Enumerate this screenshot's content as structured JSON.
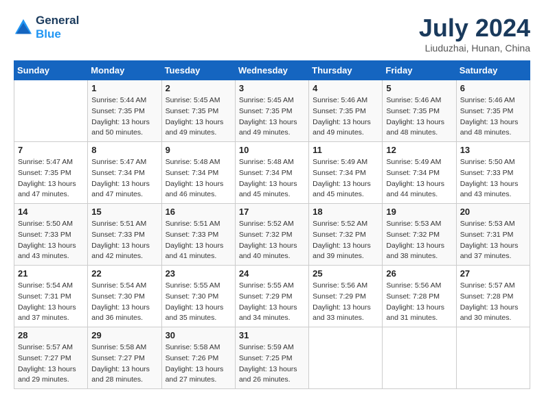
{
  "header": {
    "logo_line1": "General",
    "logo_line2": "Blue",
    "month": "July 2024",
    "location": "Liuduzhai, Hunan, China"
  },
  "weekdays": [
    "Sunday",
    "Monday",
    "Tuesday",
    "Wednesday",
    "Thursday",
    "Friday",
    "Saturday"
  ],
  "weeks": [
    [
      {
        "day": "",
        "sunrise": "",
        "sunset": "",
        "daylight": ""
      },
      {
        "day": "1",
        "sunrise": "Sunrise: 5:44 AM",
        "sunset": "Sunset: 7:35 PM",
        "daylight": "Daylight: 13 hours and 50 minutes."
      },
      {
        "day": "2",
        "sunrise": "Sunrise: 5:45 AM",
        "sunset": "Sunset: 7:35 PM",
        "daylight": "Daylight: 13 hours and 49 minutes."
      },
      {
        "day": "3",
        "sunrise": "Sunrise: 5:45 AM",
        "sunset": "Sunset: 7:35 PM",
        "daylight": "Daylight: 13 hours and 49 minutes."
      },
      {
        "day": "4",
        "sunrise": "Sunrise: 5:46 AM",
        "sunset": "Sunset: 7:35 PM",
        "daylight": "Daylight: 13 hours and 49 minutes."
      },
      {
        "day": "5",
        "sunrise": "Sunrise: 5:46 AM",
        "sunset": "Sunset: 7:35 PM",
        "daylight": "Daylight: 13 hours and 48 minutes."
      },
      {
        "day": "6",
        "sunrise": "Sunrise: 5:46 AM",
        "sunset": "Sunset: 7:35 PM",
        "daylight": "Daylight: 13 hours and 48 minutes."
      }
    ],
    [
      {
        "day": "7",
        "sunrise": "Sunrise: 5:47 AM",
        "sunset": "Sunset: 7:35 PM",
        "daylight": "Daylight: 13 hours and 47 minutes."
      },
      {
        "day": "8",
        "sunrise": "Sunrise: 5:47 AM",
        "sunset": "Sunset: 7:34 PM",
        "daylight": "Daylight: 13 hours and 47 minutes."
      },
      {
        "day": "9",
        "sunrise": "Sunrise: 5:48 AM",
        "sunset": "Sunset: 7:34 PM",
        "daylight": "Daylight: 13 hours and 46 minutes."
      },
      {
        "day": "10",
        "sunrise": "Sunrise: 5:48 AM",
        "sunset": "Sunset: 7:34 PM",
        "daylight": "Daylight: 13 hours and 45 minutes."
      },
      {
        "day": "11",
        "sunrise": "Sunrise: 5:49 AM",
        "sunset": "Sunset: 7:34 PM",
        "daylight": "Daylight: 13 hours and 45 minutes."
      },
      {
        "day": "12",
        "sunrise": "Sunrise: 5:49 AM",
        "sunset": "Sunset: 7:34 PM",
        "daylight": "Daylight: 13 hours and 44 minutes."
      },
      {
        "day": "13",
        "sunrise": "Sunrise: 5:50 AM",
        "sunset": "Sunset: 7:33 PM",
        "daylight": "Daylight: 13 hours and 43 minutes."
      }
    ],
    [
      {
        "day": "14",
        "sunrise": "Sunrise: 5:50 AM",
        "sunset": "Sunset: 7:33 PM",
        "daylight": "Daylight: 13 hours and 43 minutes."
      },
      {
        "day": "15",
        "sunrise": "Sunrise: 5:51 AM",
        "sunset": "Sunset: 7:33 PM",
        "daylight": "Daylight: 13 hours and 42 minutes."
      },
      {
        "day": "16",
        "sunrise": "Sunrise: 5:51 AM",
        "sunset": "Sunset: 7:33 PM",
        "daylight": "Daylight: 13 hours and 41 minutes."
      },
      {
        "day": "17",
        "sunrise": "Sunrise: 5:52 AM",
        "sunset": "Sunset: 7:32 PM",
        "daylight": "Daylight: 13 hours and 40 minutes."
      },
      {
        "day": "18",
        "sunrise": "Sunrise: 5:52 AM",
        "sunset": "Sunset: 7:32 PM",
        "daylight": "Daylight: 13 hours and 39 minutes."
      },
      {
        "day": "19",
        "sunrise": "Sunrise: 5:53 AM",
        "sunset": "Sunset: 7:32 PM",
        "daylight": "Daylight: 13 hours and 38 minutes."
      },
      {
        "day": "20",
        "sunrise": "Sunrise: 5:53 AM",
        "sunset": "Sunset: 7:31 PM",
        "daylight": "Daylight: 13 hours and 37 minutes."
      }
    ],
    [
      {
        "day": "21",
        "sunrise": "Sunrise: 5:54 AM",
        "sunset": "Sunset: 7:31 PM",
        "daylight": "Daylight: 13 hours and 37 minutes."
      },
      {
        "day": "22",
        "sunrise": "Sunrise: 5:54 AM",
        "sunset": "Sunset: 7:30 PM",
        "daylight": "Daylight: 13 hours and 36 minutes."
      },
      {
        "day": "23",
        "sunrise": "Sunrise: 5:55 AM",
        "sunset": "Sunset: 7:30 PM",
        "daylight": "Daylight: 13 hours and 35 minutes."
      },
      {
        "day": "24",
        "sunrise": "Sunrise: 5:55 AM",
        "sunset": "Sunset: 7:29 PM",
        "daylight": "Daylight: 13 hours and 34 minutes."
      },
      {
        "day": "25",
        "sunrise": "Sunrise: 5:56 AM",
        "sunset": "Sunset: 7:29 PM",
        "daylight": "Daylight: 13 hours and 33 minutes."
      },
      {
        "day": "26",
        "sunrise": "Sunrise: 5:56 AM",
        "sunset": "Sunset: 7:28 PM",
        "daylight": "Daylight: 13 hours and 31 minutes."
      },
      {
        "day": "27",
        "sunrise": "Sunrise: 5:57 AM",
        "sunset": "Sunset: 7:28 PM",
        "daylight": "Daylight: 13 hours and 30 minutes."
      }
    ],
    [
      {
        "day": "28",
        "sunrise": "Sunrise: 5:57 AM",
        "sunset": "Sunset: 7:27 PM",
        "daylight": "Daylight: 13 hours and 29 minutes."
      },
      {
        "day": "29",
        "sunrise": "Sunrise: 5:58 AM",
        "sunset": "Sunset: 7:27 PM",
        "daylight": "Daylight: 13 hours and 28 minutes."
      },
      {
        "day": "30",
        "sunrise": "Sunrise: 5:58 AM",
        "sunset": "Sunset: 7:26 PM",
        "daylight": "Daylight: 13 hours and 27 minutes."
      },
      {
        "day": "31",
        "sunrise": "Sunrise: 5:59 AM",
        "sunset": "Sunset: 7:25 PM",
        "daylight": "Daylight: 13 hours and 26 minutes."
      },
      {
        "day": "",
        "sunrise": "",
        "sunset": "",
        "daylight": ""
      },
      {
        "day": "",
        "sunrise": "",
        "sunset": "",
        "daylight": ""
      },
      {
        "day": "",
        "sunrise": "",
        "sunset": "",
        "daylight": ""
      }
    ]
  ]
}
